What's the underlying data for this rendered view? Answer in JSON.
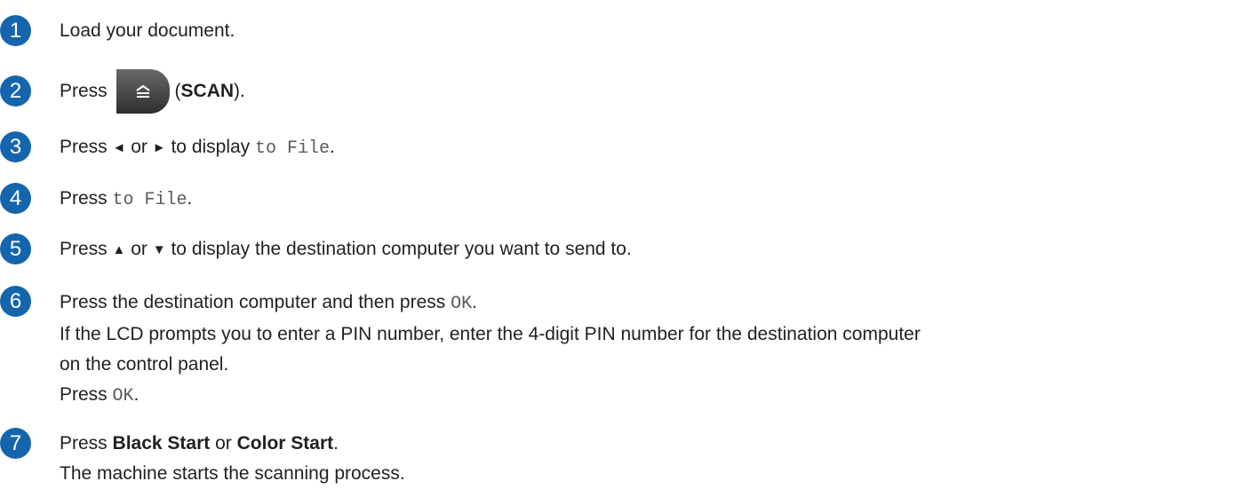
{
  "steps": [
    {
      "number": "1",
      "text": "Load your document."
    },
    {
      "number": "2",
      "prefix": "Press",
      "scan_open": "(",
      "scan_label": "SCAN",
      "scan_close": ")."
    },
    {
      "number": "3",
      "prefix": "Press",
      "left_arrow": "◄",
      "or": "or",
      "right_arrow": "►",
      "middle": "to display",
      "code": "to File",
      "suffix": "."
    },
    {
      "number": "4",
      "prefix": "Press",
      "code": "to File",
      "suffix": "."
    },
    {
      "number": "5",
      "prefix": "Press",
      "up_arrow": "▲",
      "or": "or",
      "down_arrow": "▼",
      "suffix": "to display the destination computer you want to send to."
    },
    {
      "number": "6",
      "line1": "Press the destination computer and then press",
      "code1": "OK",
      "line1_end": ".",
      "line2": "If the LCD prompts you to enter a PIN number, enter the 4-digit PIN number for the destination computer",
      "line3": "on the control panel.",
      "line4_prefix": "Press",
      "code2": "OK",
      "line4_end": "."
    },
    {
      "number": "7",
      "prefix": "Press",
      "black_start": "Black Start",
      "or": "or",
      "color_start": "Color Start",
      "suffix": ".",
      "line2": "The machine starts the scanning process."
    }
  ],
  "icons": {
    "scan_button": "scan-key-icon"
  },
  "colors": {
    "badge": "#1565ad",
    "text": "#231f20",
    "code": "#5a5a5a"
  }
}
